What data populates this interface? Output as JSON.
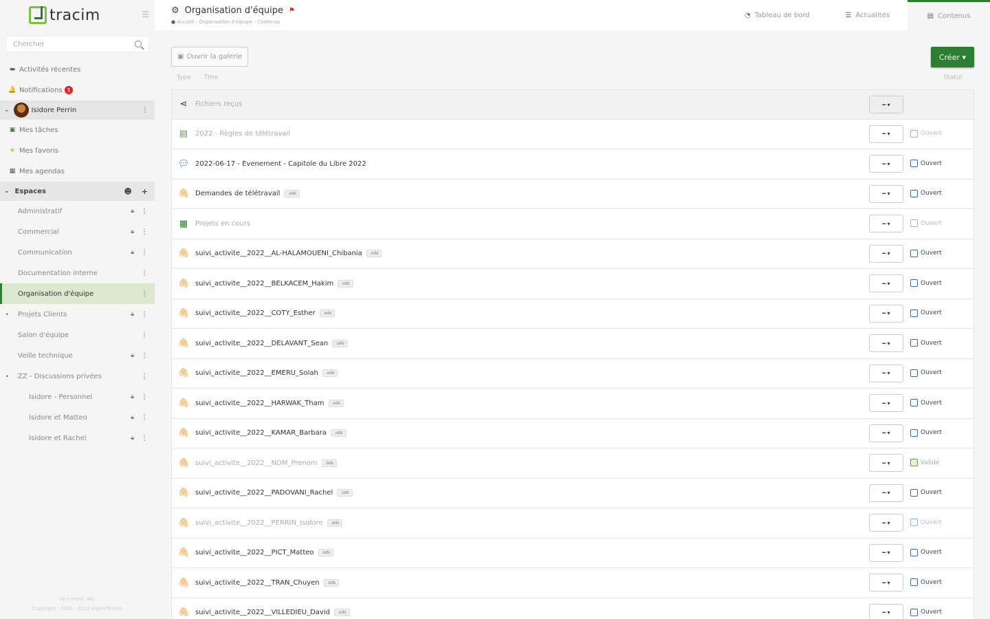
{
  "app": {
    "logo_text": "tracim"
  },
  "sidebar": {
    "search_placeholder": "Chercher",
    "nav": [
      {
        "label": "Activités récentes",
        "icon": "activity-icon"
      },
      {
        "label": "Notifications",
        "icon": "bell-icon",
        "badge": "3"
      }
    ],
    "user": {
      "name": "Isidore Perrin"
    },
    "user_items": [
      {
        "label": "Mes tâches",
        "icon": "tasks-icon"
      },
      {
        "label": "Mes favoris",
        "icon": "star-icon"
      },
      {
        "label": "Mes agendas",
        "icon": "calendar-icon"
      }
    ],
    "spaces_label": "Espaces",
    "spaces": [
      {
        "label": "Administratif",
        "lock": true
      },
      {
        "label": "Commercial",
        "lock": true
      },
      {
        "label": "Communication",
        "lock": true
      },
      {
        "label": "Documentation interne",
        "lock": false
      },
      {
        "label": "Organisation d'équipe",
        "lock": false,
        "active": true
      },
      {
        "label": "Projets Clients",
        "lock": true,
        "bullet": true
      },
      {
        "label": "Salon d'équipe",
        "lock": false
      },
      {
        "label": "Veille technique",
        "lock": true
      },
      {
        "label": "ZZ - Discussions privées",
        "lock": false,
        "bullet": true
      },
      {
        "label": "Isidore - Personnel",
        "lock": true,
        "sub": true
      },
      {
        "label": "Isidore et Matteo",
        "lock": true,
        "sub": true
      },
      {
        "label": "Isidore et Rachel",
        "lock": true,
        "sub": true
      }
    ],
    "footer_version": "vers.trusti_482",
    "footer_copyright": "Copyright - 2013 - 2022 Algoo/Tracim"
  },
  "header": {
    "title": "Organisation d'équipe",
    "breadcrumb": "Accueil › Organisation d'équipe › Contenus",
    "tabs": [
      {
        "label": "Tableau de bord",
        "icon": "dashboard-icon"
      },
      {
        "label": "Actualités",
        "icon": "news-icon"
      },
      {
        "label": "Contenus",
        "icon": "contents-icon",
        "active": true
      }
    ]
  },
  "toolbar": {
    "gallery_label": "Ouvrir la galerie",
    "create_label": "Créer",
    "col_type": "Type",
    "col_title": "Titre",
    "col_status": "Statut"
  },
  "rows": [
    {
      "type": "share",
      "title": "Fichiers reçus",
      "dim": true,
      "first": true,
      "status": ""
    },
    {
      "type": "file",
      "title": "2022 - Règles de télétravail",
      "dim": true,
      "status": "Ouvert",
      "status_dim": true
    },
    {
      "type": "thread",
      "title": "2022-06-17 - Evenement - Capitole du Libre 2022",
      "status": "Ouvert"
    },
    {
      "type": "clip",
      "title": "Demandes de télétravail",
      "ext": ".ods",
      "status": "Ouvert"
    },
    {
      "type": "kanban",
      "title": "Projets en cours",
      "dim": true,
      "status": "Ouvert",
      "status_dim": true
    },
    {
      "type": "clip",
      "title": "suivi_activite__2022__AL-HALAMOUENI_Chibania",
      "ext": ".ods",
      "status": "Ouvert"
    },
    {
      "type": "clip",
      "title": "suivi_activite__2022__BELKACEM_Hakim",
      "ext": ".ods",
      "status": "Ouvert"
    },
    {
      "type": "clip",
      "title": "suivi_activite__2022__COTY_Esther",
      "ext": ".ods",
      "status": "Ouvert"
    },
    {
      "type": "clip",
      "title": "suivi_activite__2022__DELAVANT_Sean",
      "ext": ".ods",
      "status": "Ouvert"
    },
    {
      "type": "clip",
      "title": "suivi_activite__2022__EMERU_Solah",
      "ext": ".ods",
      "status": "Ouvert"
    },
    {
      "type": "clip",
      "title": "suivi_activite__2022__HARWAK_Tham",
      "ext": ".ods",
      "status": "Ouvert"
    },
    {
      "type": "clip",
      "title": "suivi_activite__2022__KAMAR_Barbara",
      "ext": ".ods",
      "status": "Ouvert"
    },
    {
      "type": "clip",
      "title": "suivi_activite__2022__NOM_Prenom",
      "ext": ".ods",
      "dim": true,
      "status": "Validé",
      "status_valid": true
    },
    {
      "type": "clip",
      "title": "suivi_activite__2022__PADOVANI_Rachel",
      "ext": ".ods",
      "status": "Ouvert"
    },
    {
      "type": "clip",
      "title": "suivi_activite__2022__PERRIN_Isidore",
      "ext": ".ods",
      "dim": true,
      "status": "Ouvert",
      "status_dim": true
    },
    {
      "type": "clip",
      "title": "suivi_activite__2022__PICT_Matteo",
      "ext": ".ods",
      "status": "Ouvert"
    },
    {
      "type": "clip",
      "title": "suivi_activite__2022__TRAN_Chuyen",
      "ext": ".ods",
      "status": "Ouvert"
    },
    {
      "type": "clip",
      "title": "suivi_activite__2022__VILLEDIEU_David",
      "ext": ".ods",
      "status": "Ouvert"
    }
  ],
  "colors": {
    "accent": "#2e7d32",
    "badge": "#e02020",
    "link": "#3467c0",
    "file_orange": "#f39c2a"
  }
}
